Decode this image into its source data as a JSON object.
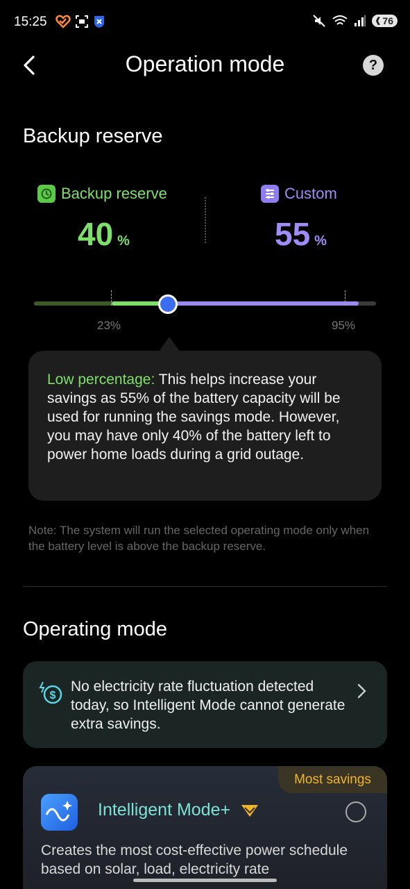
{
  "status_bar": {
    "time": "15:25",
    "battery": "76"
  },
  "header": {
    "title": "Operation mode",
    "help_label": "?"
  },
  "backup_section": {
    "title": "Backup reserve",
    "backup_label": "Backup reserve",
    "backup_value": "40",
    "custom_label": "Custom",
    "custom_value": "55",
    "pct_symbol": "%",
    "slider": {
      "min_label": "23%",
      "max_label": "95%",
      "value": 40,
      "min": 23,
      "max": 95
    },
    "tooltip_highlight": "Low percentage:",
    "tooltip_body": " This helps increase your savings as 55% of the battery capacity will be used for running the savings mode. However, you may have only 40% of the battery left to power home loads during a grid outage.",
    "note": "Note: The system will run the selected operating mode only when the battery level is above the backup reserve."
  },
  "operating_section": {
    "title": "Operating mode",
    "info_text": "No electricity rate fluctuation detected today, so Intelligent Mode cannot generate extra savings.",
    "mode_card": {
      "badge": "Most savings",
      "title": "Intelligent Mode+",
      "description": "Creates the most cost-effective power schedule based on solar, load, electricity rate"
    }
  },
  "colors": {
    "green": "#7ee06a",
    "purple": "#a08cf5",
    "thumb": "#3a6df0",
    "badge": "#f0b528"
  }
}
